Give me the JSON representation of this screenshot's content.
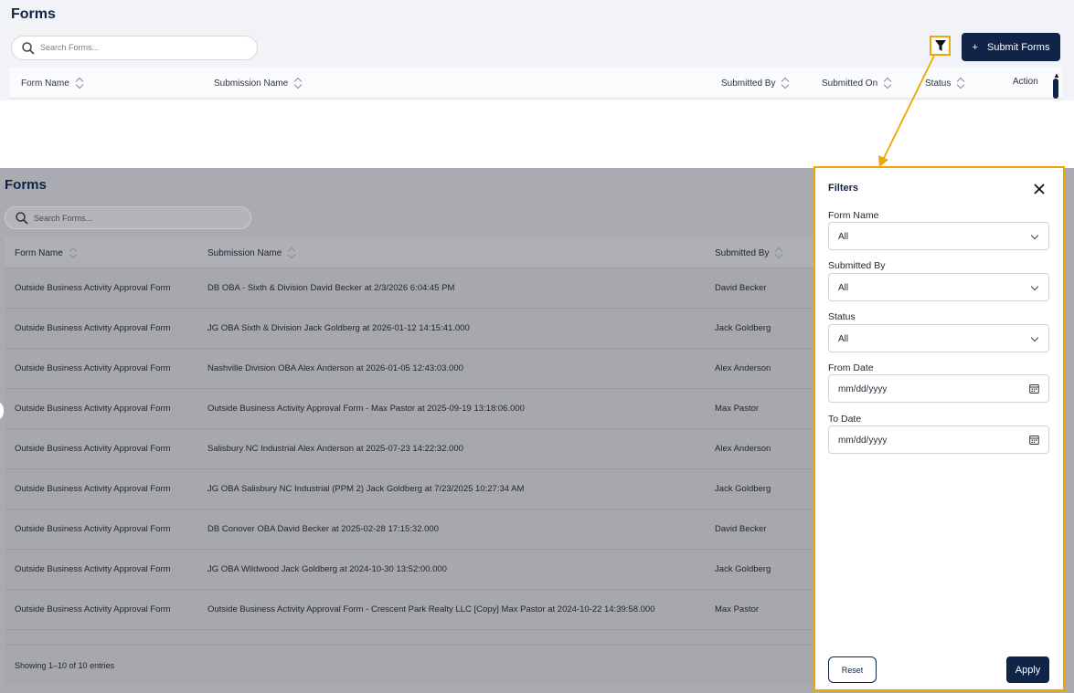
{
  "top": {
    "title": "Forms",
    "search_placeholder": "Search Forms...",
    "submit_label": "Submit Forms",
    "columns": [
      "Form Name",
      "Submission Name",
      "Submitted By",
      "Submitted On",
      "Status",
      "Action"
    ]
  },
  "main": {
    "title": "Forms",
    "search_placeholder": "Search Forms...",
    "columns": [
      "Form Name",
      "Submission Name",
      "Submitted By"
    ],
    "rows": [
      {
        "form": "Outside Business Activity Approval Form",
        "submission": "DB OBA - Sixth & Division David Becker at 2/3/2026 6:04:45 PM",
        "by": "David Becker"
      },
      {
        "form": "Outside Business Activity Approval Form",
        "submission": "JG OBA Sixth & Division Jack Goldberg at 2026-01-12 14:15:41.000",
        "by": "Jack Goldberg"
      },
      {
        "form": "Outside Business Activity Approval Form",
        "submission": "Nashville Division OBA Alex Anderson at 2026-01-05 12:43:03.000",
        "by": "Alex Anderson"
      },
      {
        "form": "Outside Business Activity Approval Form",
        "submission": "Outside Business Activity Approval Form - Max Pastor at 2025-09-19 13:18:06.000",
        "by": "Max Pastor"
      },
      {
        "form": "Outside Business Activity Approval Form",
        "submission": "Salisbury NC Industrial Alex Anderson at 2025-07-23 14:22:32.000",
        "by": "Alex Anderson"
      },
      {
        "form": "Outside Business Activity Approval Form",
        "submission": "JG OBA Salisbury NC Industrial (PPM 2) Jack Goldberg at 7/23/2025 10:27:34 AM",
        "by": "Jack Goldberg"
      },
      {
        "form": "Outside Business Activity Approval Form",
        "submission": "DB Conover OBA David Becker at 2025-02-28 17:15:32.000",
        "by": "David Becker"
      },
      {
        "form": "Outside Business Activity Approval Form",
        "submission": "JG OBA Wildwood Jack Goldberg at 2024-10-30 13:52:00.000",
        "by": "Jack Goldberg"
      },
      {
        "form": "Outside Business Activity Approval Form",
        "submission": "Outside Business Activity Approval Form - Crescent Park Realty LLC [Copy] Max Pastor at 2024-10-22 14:39:58.000",
        "by": "Max Pastor"
      }
    ],
    "footer": "Showing 1–10 of 10 entries"
  },
  "filters": {
    "title": "Filters",
    "form_name_label": "Form Name",
    "form_name_value": "All",
    "submitted_by_label": "Submitted By",
    "submitted_by_value": "All",
    "status_label": "Status",
    "status_value": "All",
    "from_date_label": "From Date",
    "from_date_placeholder": "mm/dd/yyyy",
    "to_date_label": "To Date",
    "to_date_placeholder": "mm/dd/yyyy",
    "reset_label": "Reset",
    "apply_label": "Apply"
  },
  "colors": {
    "brand_navy": "#0f2447",
    "highlight": "#f0a500",
    "overlay": "#a9abb0"
  },
  "icons": [
    "search-icon",
    "filter-icon",
    "plus-icon",
    "sort-icon",
    "close-icon",
    "chevron-down-icon",
    "calendar-icon"
  ]
}
